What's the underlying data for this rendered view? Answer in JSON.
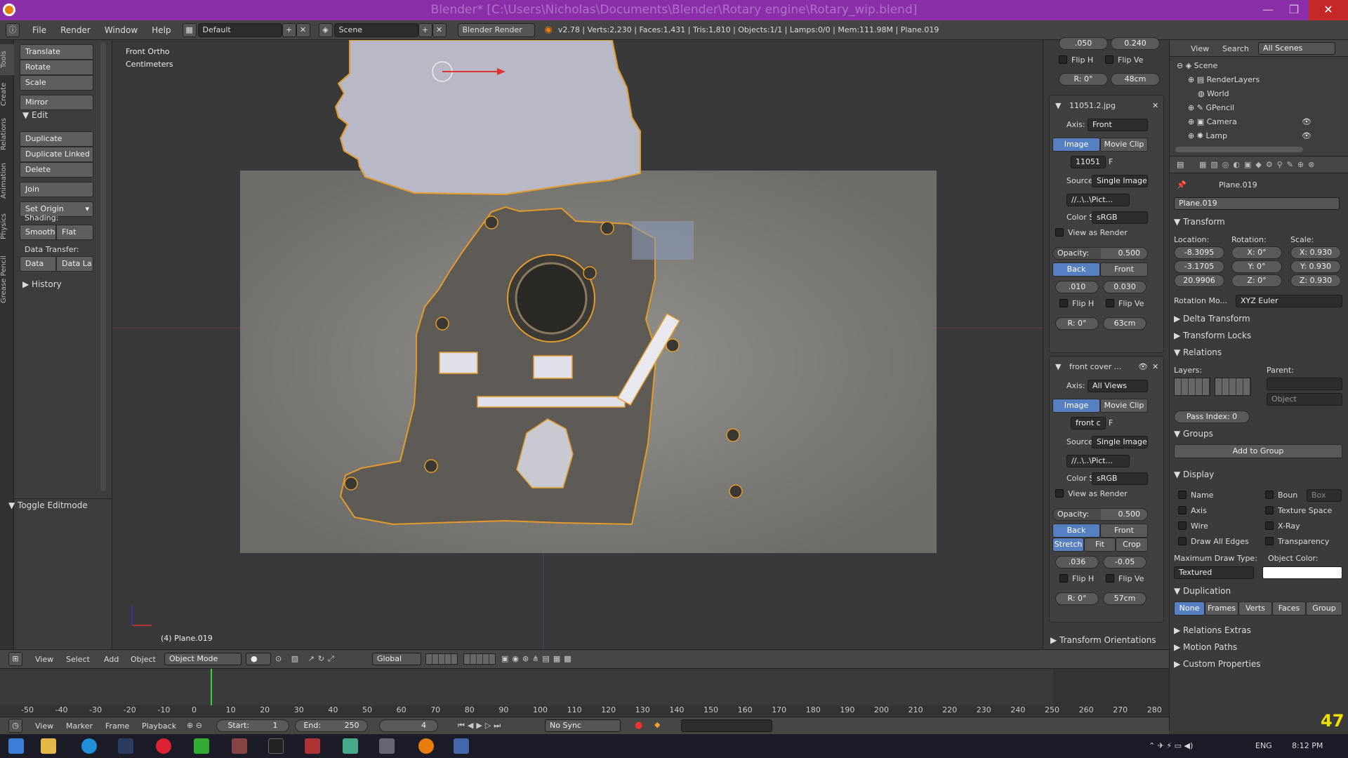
{
  "window": {
    "title": "Blender* [C:\\Users\\Nicholas\\Documents\\Blender\\Rotary engine\\Rotary_wip.blend]",
    "min": "—",
    "max": "❐",
    "close": "✕"
  },
  "info": {
    "menus": [
      "File",
      "Render",
      "Window",
      "Help"
    ],
    "layout": "Default",
    "scene": "Scene",
    "engine": "Blender Render",
    "stats": "v2.78 | Verts:2,230 | Faces:1,431 | Tris:1,810 | Objects:1/1 | Lamps:0/0 | Mem:111.98M | Plane.019"
  },
  "toolshelf": {
    "tabs": [
      "Tools",
      "Create",
      "Relations",
      "Animation",
      "Physics",
      "Grease Pencil"
    ],
    "transform": [
      "Translate",
      "Rotate",
      "Scale"
    ],
    "mirror": "Mirror",
    "edit_header": "Edit",
    "edit": [
      "Duplicate",
      "Duplicate Linked",
      "Delete"
    ],
    "join": "Join",
    "set_origin": "Set Origin",
    "shading_label": "Shading:",
    "smooth": "Smooth",
    "flat": "Flat",
    "data_transfer_label": "Data Transfer:",
    "data": "Data",
    "data_la": "Data La",
    "history": "History",
    "toggle_editmode": "Toggle Editmode"
  },
  "viewport": {
    "view_name": "Front Ortho",
    "units": "Centimeters",
    "object_label": "(4) Plane.019"
  },
  "npanel": {
    "top": {
      "val1": ".050",
      "val2": "0.240",
      "flip_h": "Flip H",
      "flip_v": "Flip Ve",
      "rot": "R: 0°",
      "size": "48cm"
    },
    "bg1": {
      "name": "11051.2.jpg",
      "axis_label": "Axis:",
      "axis": "Front",
      "image": "Image",
      "movie_clip": "Movie Clip",
      "img_field": "11051",
      "f": "F",
      "source_label": "Source",
      "source": "Single Image",
      "path": "//..\\..\\Pict...",
      "color_label": "Color S",
      "color": "sRGB",
      "view_as_render": "View as Render",
      "opacity_label": "Opacity:",
      "opacity": "0.500",
      "back": "Back",
      "front": "Front",
      "x": ".010",
      "y": "0.030",
      "flip_h": "Flip H",
      "flip_v": "Flip Ve",
      "rot": "R: 0°",
      "size": "63cm"
    },
    "bg2": {
      "name": "front cover ...",
      "axis_label": "Axis:",
      "axis": "All Views",
      "image": "Image",
      "movie_clip": "Movie Clip",
      "img_field": "front c",
      "f": "F",
      "source_label": "Source",
      "source": "Single Image",
      "path": "//..\\..\\Pict...",
      "color_label": "Color S",
      "color": "sRGB",
      "view_as_render": "View as Render",
      "opacity_label": "Opacity:",
      "opacity": "0.500",
      "back": "Back",
      "front": "Front",
      "stretch": "Stretch",
      "fit": "Fit",
      "crop": "Crop",
      "x": ".036",
      "y": "-0.05",
      "flip_h": "Flip H",
      "flip_v": "Flip Ve",
      "rot": "R: 0°",
      "size": "57cm"
    },
    "transform_orientations": "Transform Orientations"
  },
  "outliner": {
    "view": "View",
    "search": "Search",
    "filter": "All Scenes",
    "items": [
      "Scene",
      "RenderLayers",
      "World",
      "GPencil",
      "Camera",
      "Lamp"
    ]
  },
  "properties": {
    "object_name": "Plane.019",
    "breadcrumb": "Plane.019",
    "transform": "Transform",
    "location_label": "Location:",
    "rotation_label": "Rotation:",
    "scale_label": "Scale:",
    "loc": [
      "-8.3095",
      "-3.1705",
      "20.9906"
    ],
    "rot": [
      "X:",
      "0°",
      "Y:",
      "0°",
      "Z:",
      "0°"
    ],
    "scale": [
      "X: 0.930",
      "Y: 0.930",
      "Z: 0.930"
    ],
    "rotation_mode_label": "Rotation Mo...",
    "rotation_mode": "XYZ Euler",
    "delta_transform": "Delta Transform",
    "transform_locks": "Transform Locks",
    "relations": "Relations",
    "layers_label": "Layers:",
    "parent_label": "Parent:",
    "parent_type": "Object",
    "pass_index": "Pass Index:",
    "pass_index_value": "0",
    "groups": "Groups",
    "add_to_group": "Add to Group",
    "display": "Display",
    "disp_left": [
      "Name",
      "Axis",
      "Wire",
      "Draw All Edges"
    ],
    "disp_right": [
      "Boun",
      "Texture Space",
      "X-Ray",
      "Transparency"
    ],
    "box": "Box",
    "max_draw_label": "Maximum Draw Type:",
    "max_draw": "Textured",
    "object_color_label": "Object Color:",
    "duplication": "Duplication",
    "dup_options": [
      "None",
      "Frames",
      "Verts",
      "Faces",
      "Group"
    ],
    "relations_extras": "Relations Extras",
    "motion_paths": "Motion Paths",
    "custom_properties": "Custom Properties"
  },
  "view3d_header": {
    "menus": [
      "View",
      "Select",
      "Add",
      "Object"
    ],
    "mode": "Object Mode",
    "orientation": "Global"
  },
  "timeline": {
    "ruler": [
      "-50",
      "-40",
      "-30",
      "-20",
      "-10",
      "0",
      "10",
      "20",
      "30",
      "40",
      "50",
      "60",
      "70",
      "80",
      "90",
      "100",
      "110",
      "120",
      "130",
      "140",
      "150",
      "160",
      "170",
      "180",
      "190",
      "200",
      "210",
      "220",
      "230",
      "240",
      "250",
      "260",
      "270",
      "280"
    ],
    "menus": [
      "View",
      "Marker",
      "Frame",
      "Playback"
    ],
    "start": "Start:",
    "start_value": "1",
    "end": "End:",
    "end_value": "250",
    "current": "4",
    "sync": "No Sync"
  },
  "taskbar": {
    "lang": "ENG",
    "time": "8:12 PM",
    "fps": "47"
  },
  "colors": {
    "accent": "#5680c2",
    "titlebar": "#8b2fa8",
    "selection": "#f0a030"
  }
}
